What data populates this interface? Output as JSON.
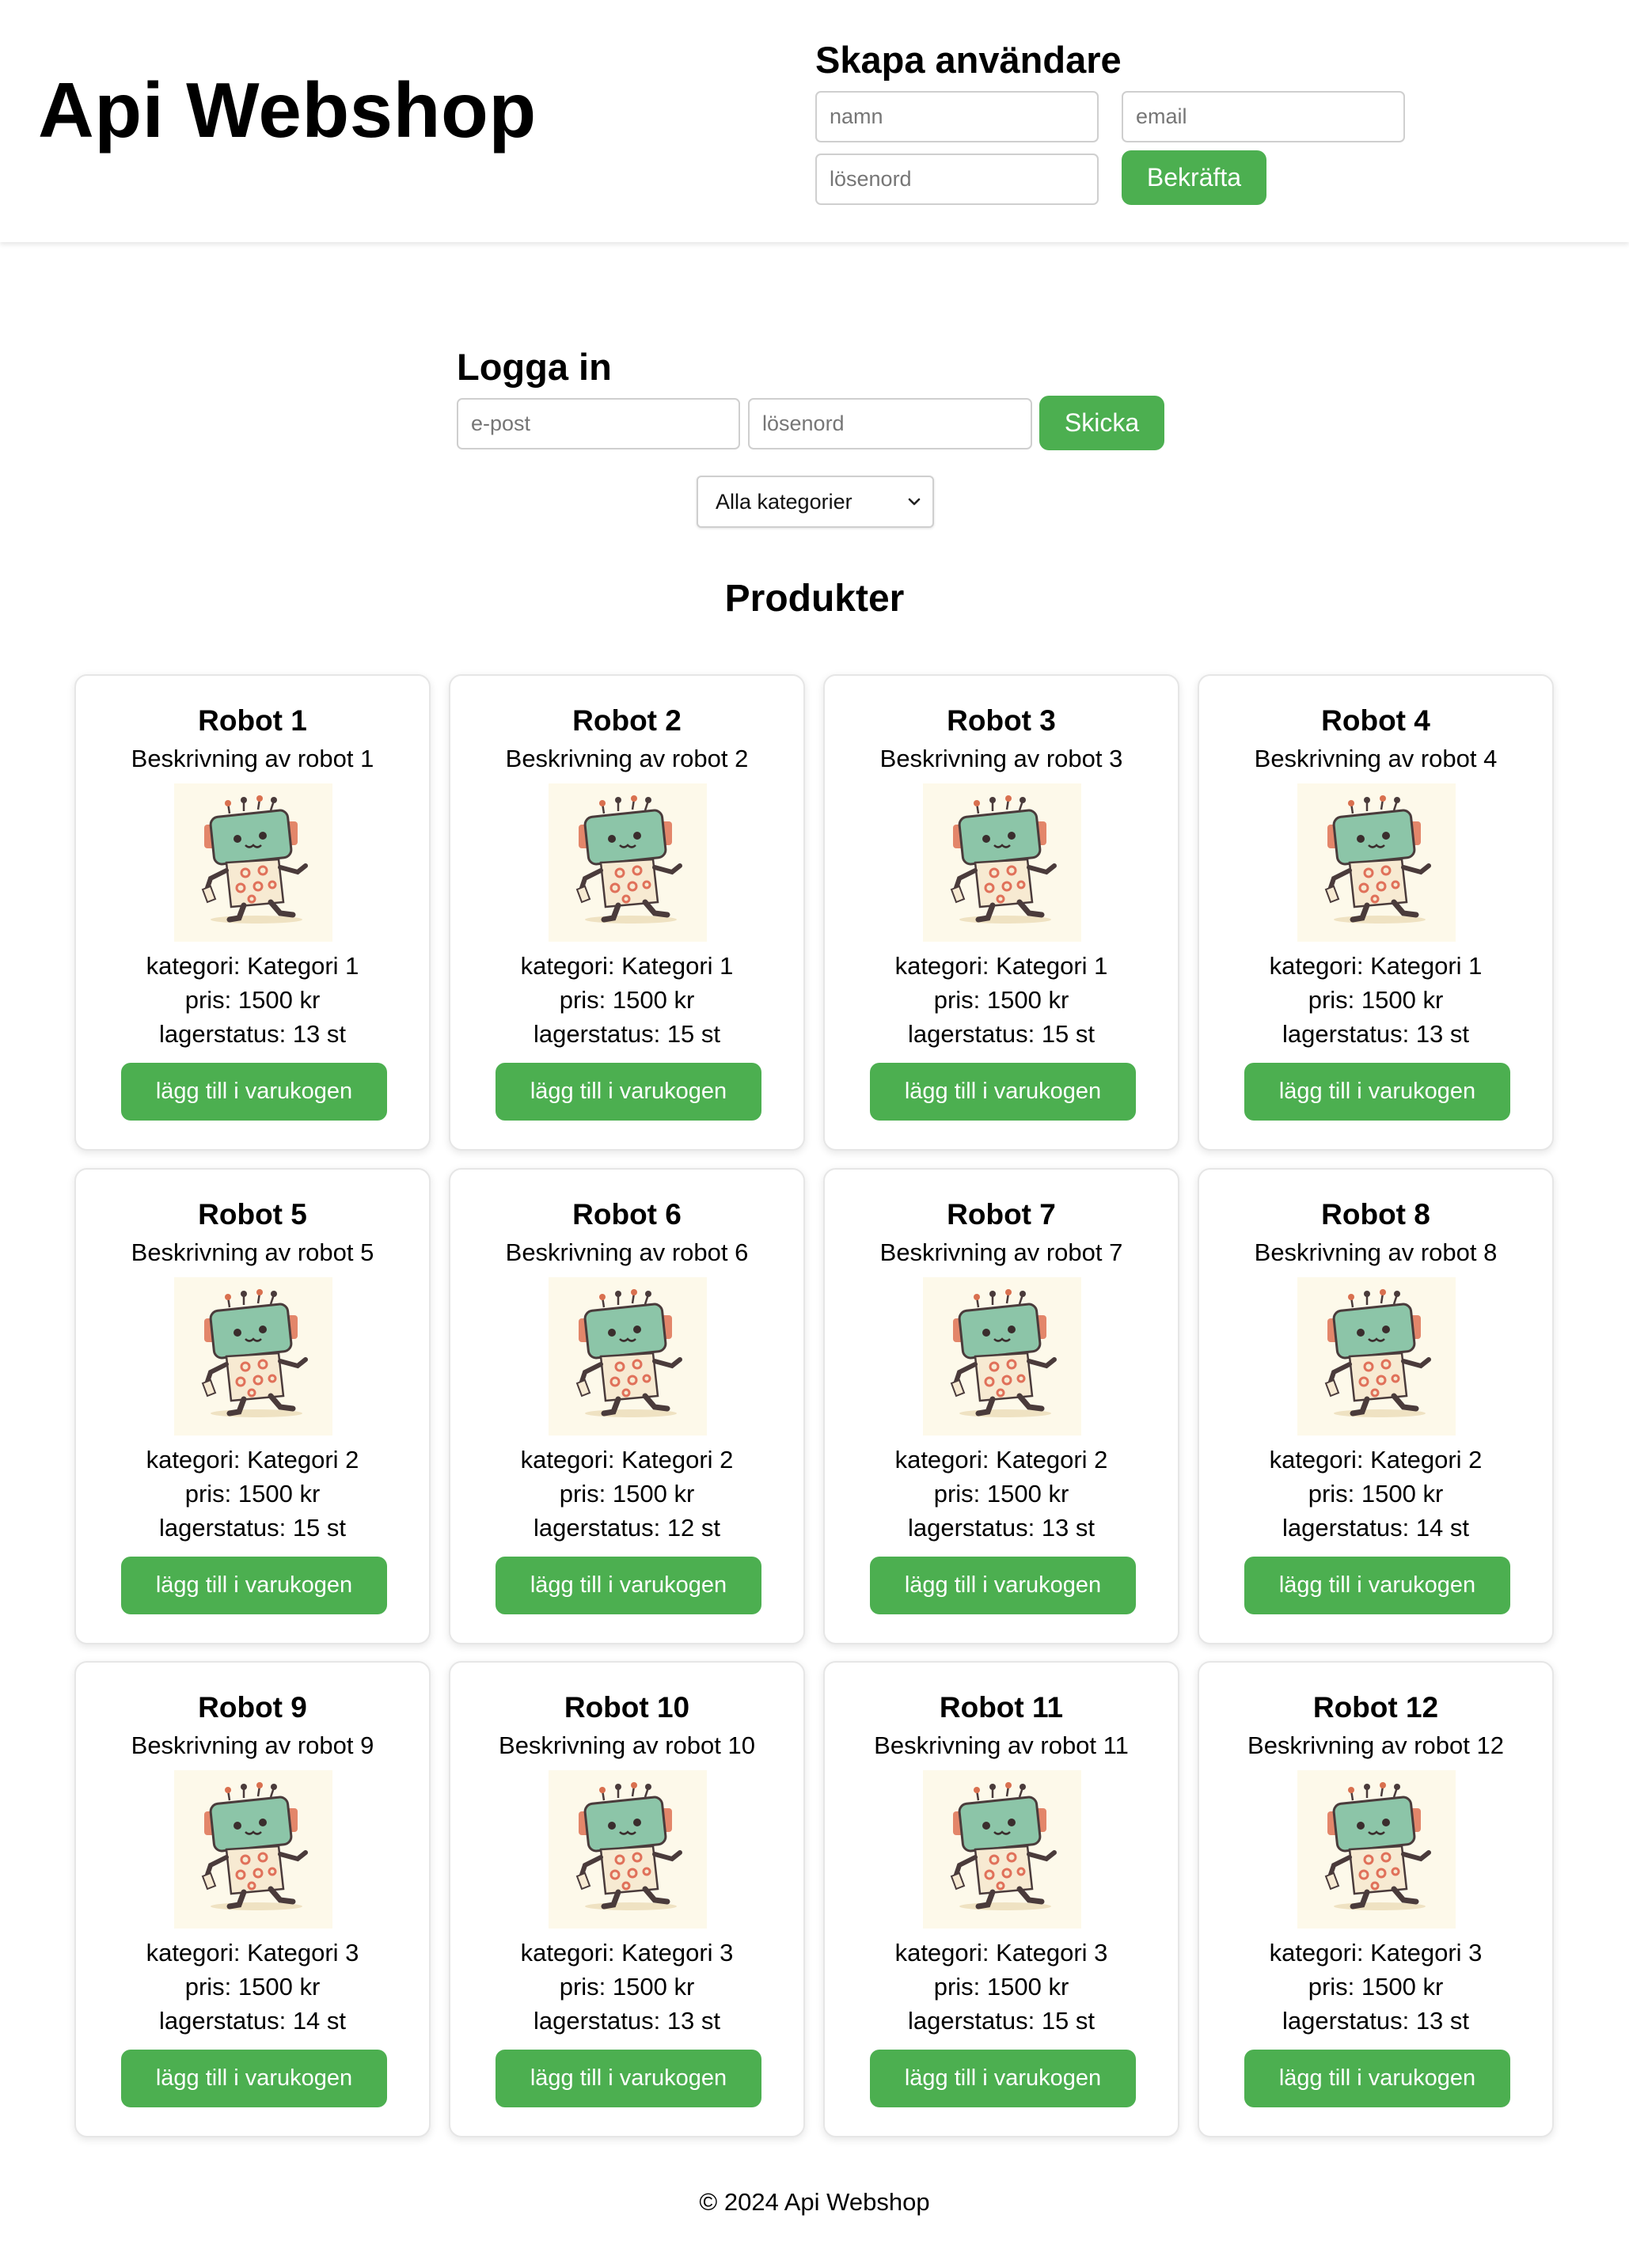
{
  "header": {
    "site_title": "Api Webshop",
    "signup": {
      "title": "Skapa användare",
      "name_placeholder": "namn",
      "email_placeholder": "email",
      "password_placeholder": "lösenord",
      "submit_label": "Bekräfta"
    }
  },
  "login": {
    "title": "Logga in",
    "email_placeholder": "e-post",
    "password_placeholder": "lösenord",
    "submit_label": "Skicka"
  },
  "filter": {
    "selected": "Alla kategorier",
    "chevron_icon": "chevron-down-icon"
  },
  "products_title": "Produkter",
  "products": [
    {
      "name": "Robot 1",
      "description": "Beskrivning av robot 1",
      "category": "kategori: Kategori 1",
      "price": "pris: 1500 kr",
      "stock": "lagerstatus: 13 st",
      "button": "lägg till i varukogen"
    },
    {
      "name": "Robot 2",
      "description": "Beskrivning av robot 2",
      "category": "kategori: Kategori 1",
      "price": "pris: 1500 kr",
      "stock": "lagerstatus: 15 st",
      "button": "lägg till i varukogen"
    },
    {
      "name": "Robot 3",
      "description": "Beskrivning av robot 3",
      "category": "kategori: Kategori 1",
      "price": "pris: 1500 kr",
      "stock": "lagerstatus: 15 st",
      "button": "lägg till i varukogen"
    },
    {
      "name": "Robot 4",
      "description": "Beskrivning av robot 4",
      "category": "kategori: Kategori 1",
      "price": "pris: 1500 kr",
      "stock": "lagerstatus: 13 st",
      "button": "lägg till i varukogen"
    },
    {
      "name": "Robot 5",
      "description": "Beskrivning av robot 5",
      "category": "kategori: Kategori 2",
      "price": "pris: 1500 kr",
      "stock": "lagerstatus: 15 st",
      "button": "lägg till i varukogen"
    },
    {
      "name": "Robot 6",
      "description": "Beskrivning av robot 6",
      "category": "kategori: Kategori 2",
      "price": "pris: 1500 kr",
      "stock": "lagerstatus: 12 st",
      "button": "lägg till i varukogen"
    },
    {
      "name": "Robot 7",
      "description": "Beskrivning av robot 7",
      "category": "kategori: Kategori 2",
      "price": "pris: 1500 kr",
      "stock": "lagerstatus: 13 st",
      "button": "lägg till i varukogen"
    },
    {
      "name": "Robot 8",
      "description": "Beskrivning av robot 8",
      "category": "kategori: Kategori 2",
      "price": "pris: 1500 kr",
      "stock": "lagerstatus: 14 st",
      "button": "lägg till i varukogen"
    },
    {
      "name": "Robot 9",
      "description": "Beskrivning av robot 9",
      "category": "kategori: Kategori 3",
      "price": "pris: 1500 kr",
      "stock": "lagerstatus: 14 st",
      "button": "lägg till i varukogen"
    },
    {
      "name": "Robot 10",
      "description": "Beskrivning av robot 10",
      "category": "kategori: Kategori 3",
      "price": "pris: 1500 kr",
      "stock": "lagerstatus: 13 st",
      "button": "lägg till i varukogen"
    },
    {
      "name": "Robot 11",
      "description": "Beskrivning av robot 11",
      "category": "kategori: Kategori 3",
      "price": "pris: 1500 kr",
      "stock": "lagerstatus: 15 st",
      "button": "lägg till i varukogen"
    },
    {
      "name": "Robot 12",
      "description": "Beskrivning av robot 12",
      "category": "kategori: Kategori 3",
      "price": "pris: 1500 kr",
      "stock": "lagerstatus: 13 st",
      "button": "lägg till i varukogen"
    }
  ],
  "footer": "© 2024 Api Webshop",
  "colors": {
    "accent": "#4caf50",
    "image_bg": "#fdf9ea",
    "robot_head": "#8cc5a8"
  }
}
